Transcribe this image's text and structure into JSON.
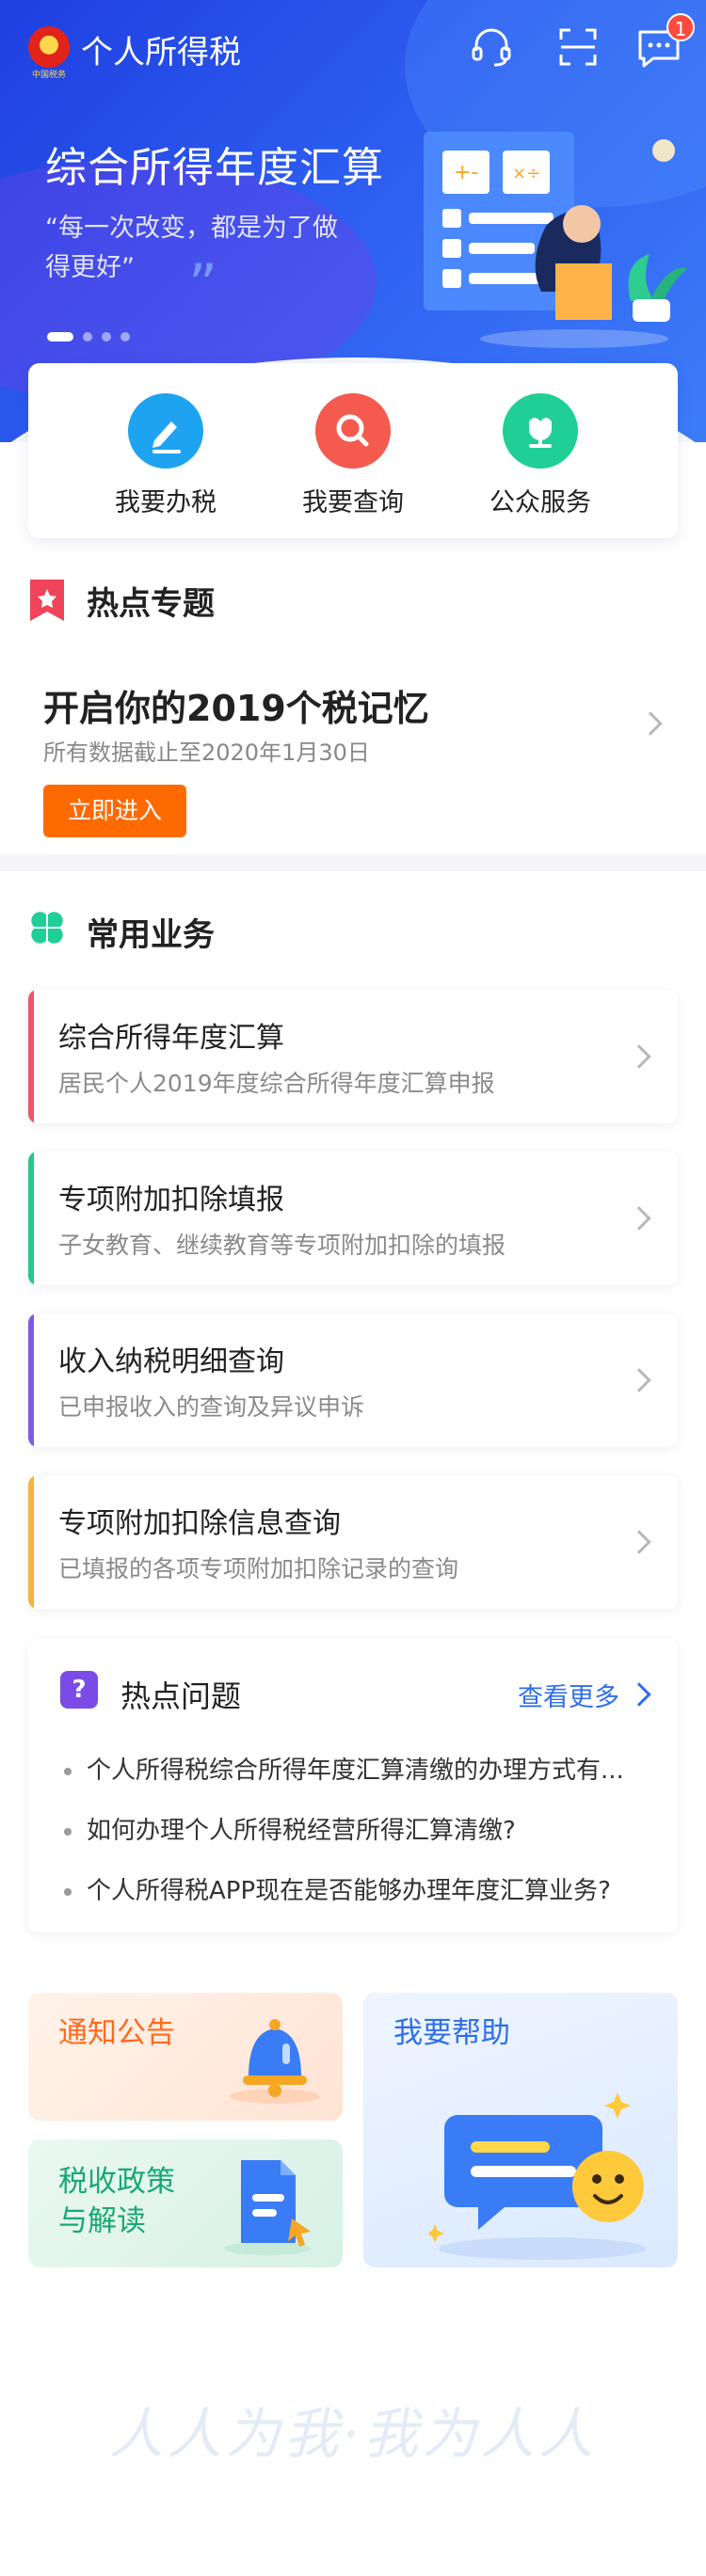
{
  "header": {
    "app_title": "个人所得税",
    "logo_text": "中国税务",
    "message_badge": "1"
  },
  "banner": {
    "title": "综合所得年度汇算",
    "quote": "“每一次改变，都是为了做得更好”",
    "active_slide": 1,
    "slide_count": 4
  },
  "quick_actions": [
    {
      "label": "我要办税",
      "icon": "pen-icon",
      "color": "#1ea3f0"
    },
    {
      "label": "我要查询",
      "icon": "search-icon",
      "color": "#f45a4e"
    },
    {
      "label": "公众服务",
      "icon": "flower-icon",
      "color": "#1fcf95"
    }
  ],
  "hot_topic": {
    "section_title": "热点专题",
    "title": "开启你的2019个税记忆",
    "subtitle": "所有数据截止至2020年1月30日",
    "button": "立即进入"
  },
  "common_services": {
    "section_title": "常用业务",
    "items": [
      {
        "title": "综合所得年度汇算",
        "subtitle": "居民个人2019年度综合所得年度汇算申报",
        "accent": "#f0536a"
      },
      {
        "title": "专项附加扣除填报",
        "subtitle": "子女教育、继续教育等专项附加扣除的填报",
        "accent": "#24c98a"
      },
      {
        "title": "收入纳税明细查询",
        "subtitle": "已申报收入的查询及异议申诉",
        "accent": "#7d5be8"
      },
      {
        "title": "专项附加扣除信息查询",
        "subtitle": "已填报的各项专项附加扣除记录的查询",
        "accent": "#f5b342"
      }
    ]
  },
  "hot_questions": {
    "title": "热点问题",
    "more": "查看更多",
    "items": [
      "个人所得税综合所得年度汇算清缴的办理方式有...",
      "如何办理个人所得税经营所得汇算清缴?",
      "个人所得税APP现在是否能够办理年度汇算业务?"
    ]
  },
  "tiles": {
    "notice": "通知公告",
    "policy_line1": "税收政策",
    "policy_line2": "与解读",
    "help": "我要帮助"
  },
  "footer": {
    "slogan": "人人为我·我为人人"
  }
}
